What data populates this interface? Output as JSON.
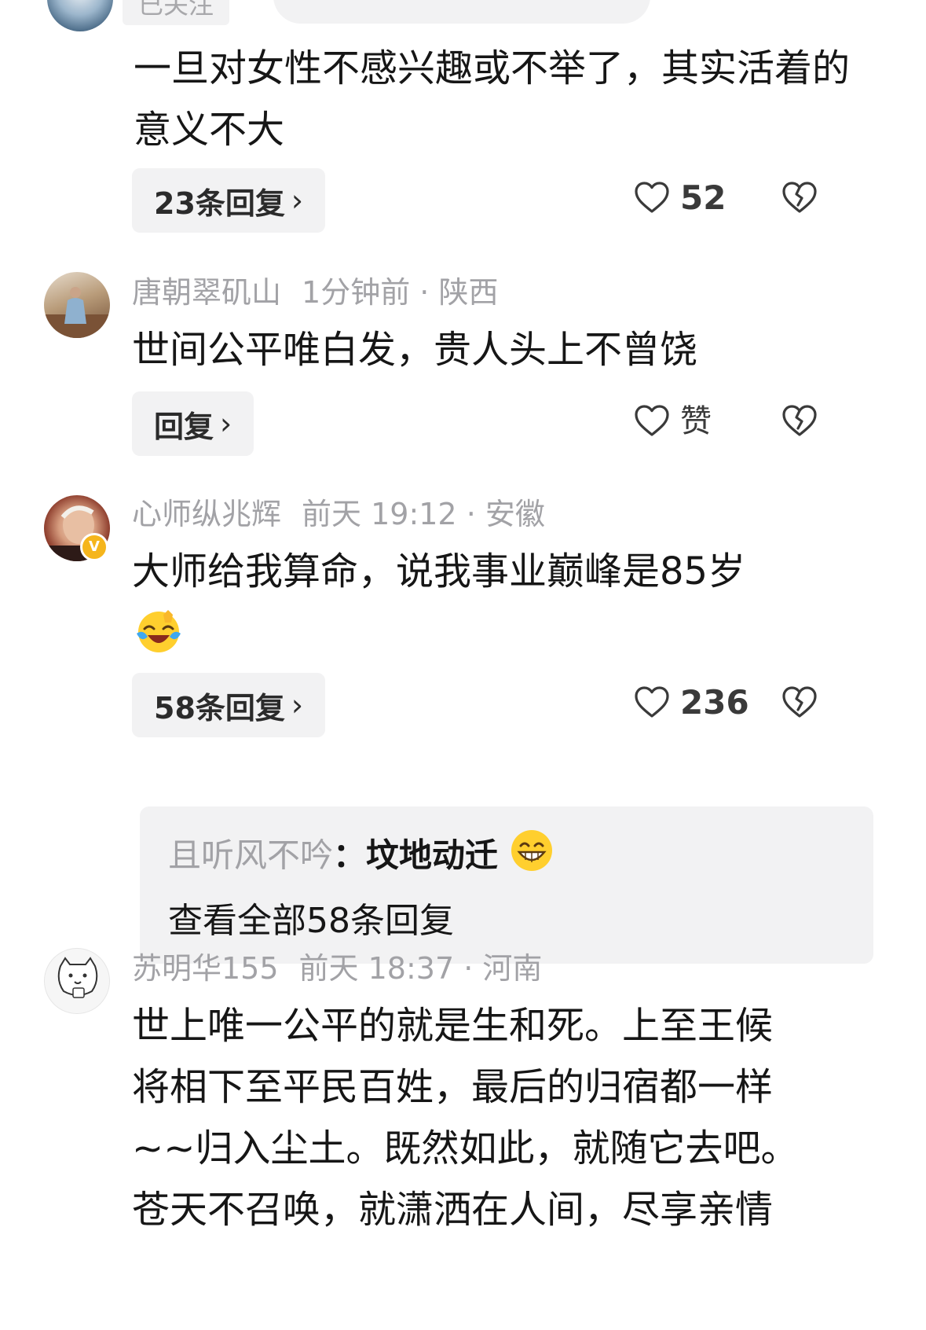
{
  "top": {
    "followed_label": "已关注",
    "comment_text": "一旦对女性不感兴趣或不举了，其实活着的意义不大",
    "reply_label": "23条回复",
    "like_count": "52"
  },
  "comments": [
    {
      "username": "唐朝翠矶山",
      "time": "1分钟前",
      "location": "陕西",
      "text": "世间公平唯白发，贵人头上不曾饶",
      "reply_label": "回复",
      "like_label": "赞"
    },
    {
      "username": "心师纵兆辉",
      "time": "前天 19:12",
      "location": "安徽",
      "verified_badge": "V",
      "text": "大师给我算命，说我事业巅峰是85岁",
      "emoji": "laughing-crying-emoji",
      "reply_label": "58条回复",
      "like_count": "236",
      "sub_reply": {
        "username": "且听风不吟",
        "text": "坟地动迁",
        "emoji": "grinning-emoji",
        "view_all": "查看全部58条回复"
      }
    },
    {
      "username": "苏明华155",
      "time": "前天 18:37",
      "location": "河南",
      "text_lines": [
        "世上唯一公平的就是生和死。上至王候",
        "将相下至平民百姓，最后的归宿都一样",
        "~~归入尘土。既然如此，就随它去吧。",
        "苍天不召唤，就潇洒在人间，尽享亲情"
      ]
    }
  ],
  "ui": {
    "separator": "·",
    "chevron": "›",
    "colon": "："
  }
}
